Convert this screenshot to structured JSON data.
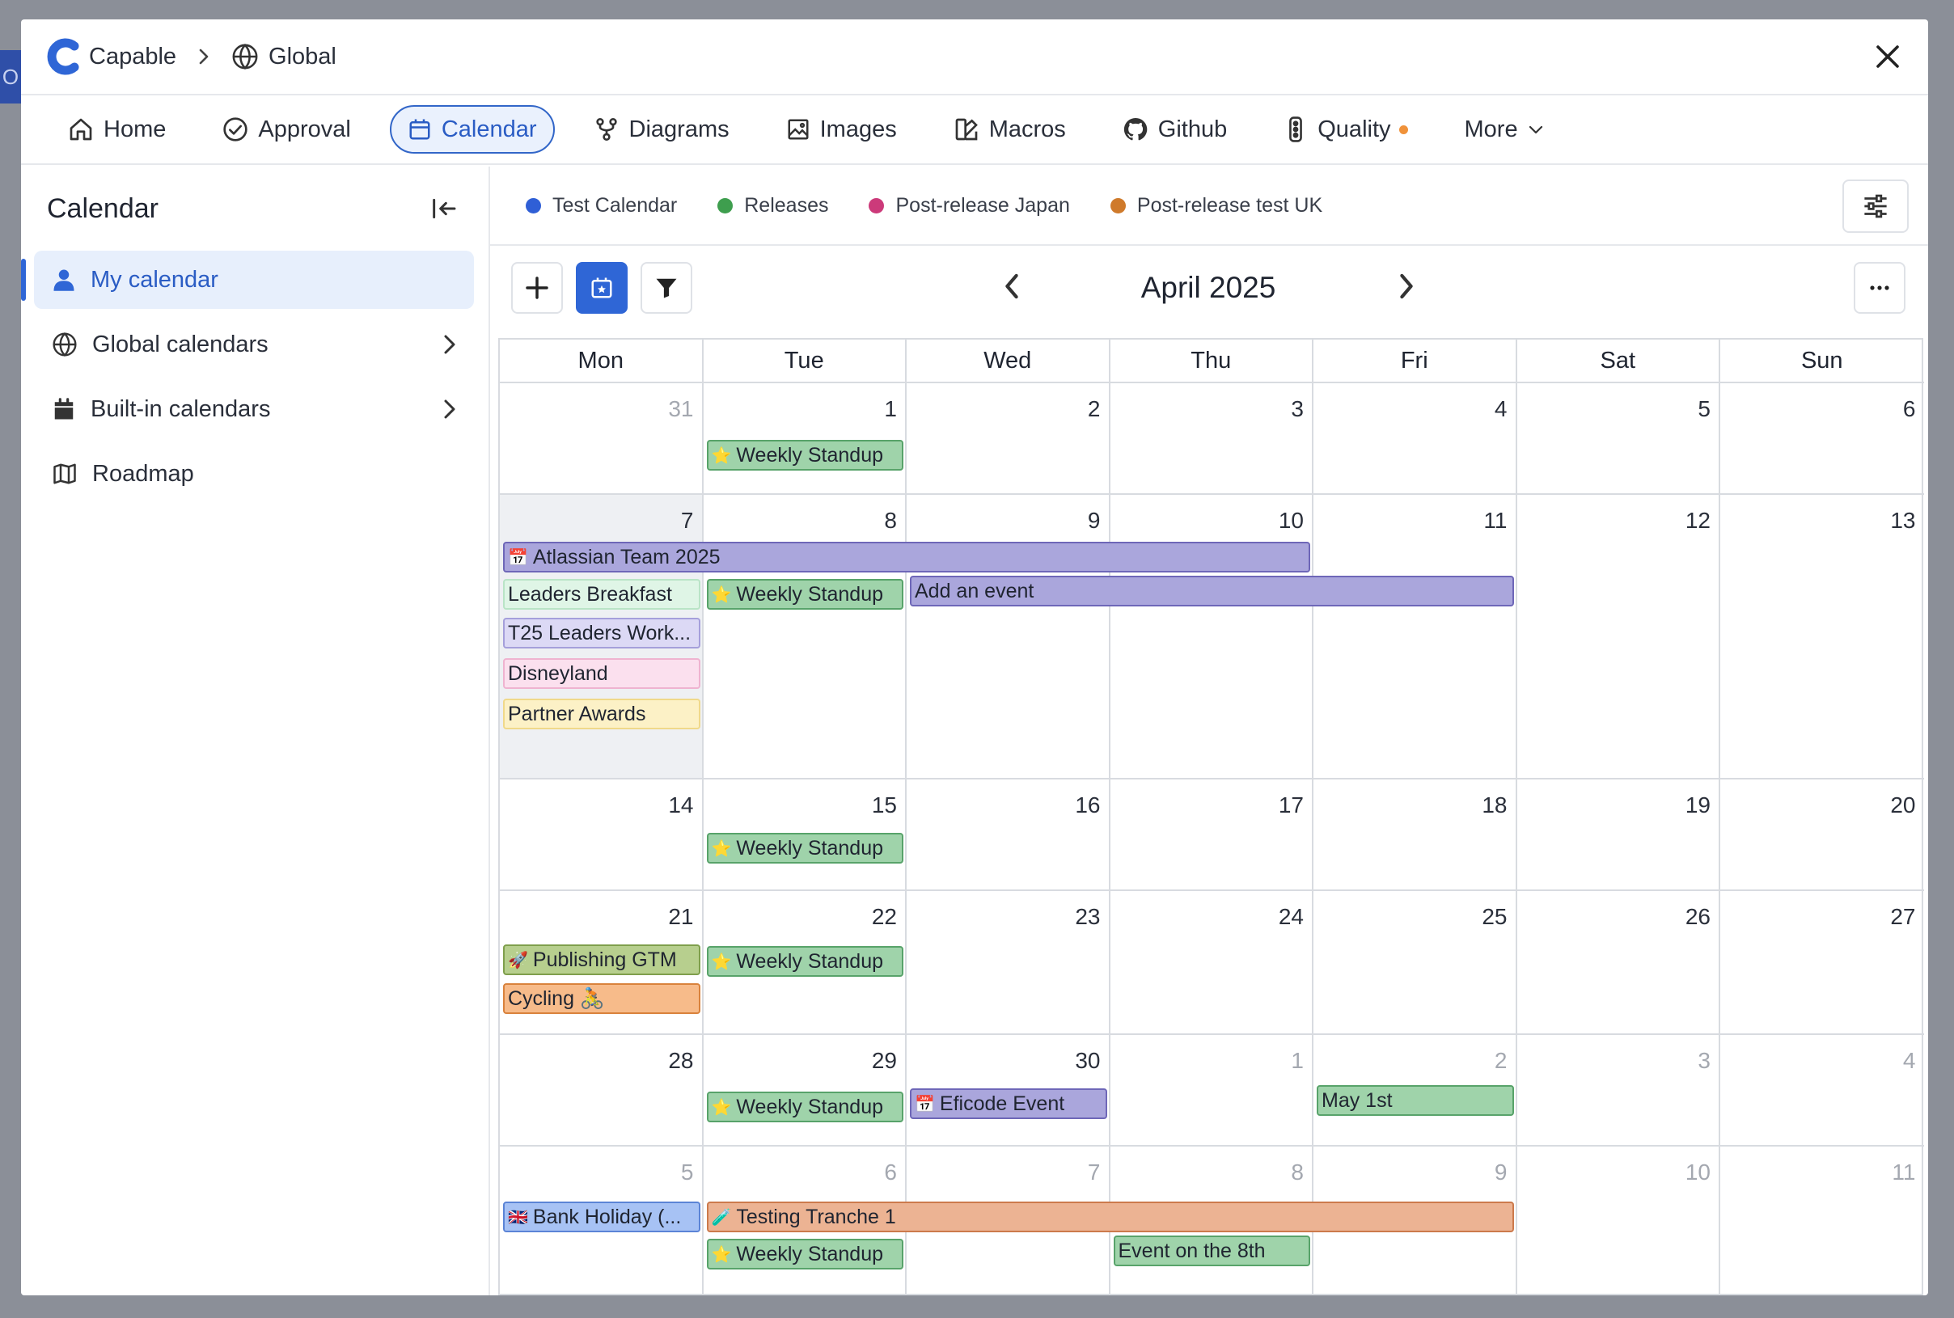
{
  "breadcrumb": [
    "Capable",
    "Global"
  ],
  "nav": [
    {
      "label": "Home",
      "icon": "home-icon"
    },
    {
      "label": "Approval",
      "icon": "check-circle-icon"
    },
    {
      "label": "Calendar",
      "icon": "calendar-icon",
      "active": true
    },
    {
      "label": "Diagrams",
      "icon": "diagram-icon"
    },
    {
      "label": "Images",
      "icon": "image-icon"
    },
    {
      "label": "Macros",
      "icon": "macro-icon"
    },
    {
      "label": "Github",
      "icon": "github-icon"
    },
    {
      "label": "Quality",
      "icon": "traffic-light-icon",
      "badge_color": "#f0923a"
    },
    {
      "label": "More",
      "icon": "chevron-down-icon"
    }
  ],
  "sidebar": {
    "title": "Calendar",
    "items": [
      {
        "label": "My calendar",
        "icon": "user-icon",
        "active": true
      },
      {
        "label": "Global calendars",
        "icon": "globe-icon"
      },
      {
        "label": "Built-in calendars",
        "icon": "calendar-filled-icon"
      },
      {
        "label": "Roadmap",
        "icon": "map-icon"
      }
    ]
  },
  "legend": [
    {
      "label": "Test Calendar",
      "color": "#2f5fd6"
    },
    {
      "label": "Releases",
      "color": "#3e9e4e"
    },
    {
      "label": "Post-release Japan",
      "color": "#cc3a7a"
    },
    {
      "label": "Post-release test UK",
      "color": "#cf7a2b"
    }
  ],
  "toolbar": {
    "month": "April 2025"
  },
  "calendar": {
    "weekdays": [
      "Mon",
      "Tue",
      "Wed",
      "Thu",
      "Fri",
      "Sat",
      "Sun"
    ],
    "weeks": [
      [
        "31",
        "1",
        "2",
        "3",
        "4",
        "5",
        "6"
      ],
      [
        "7",
        "8",
        "9",
        "10",
        "11",
        "12",
        "13"
      ],
      [
        "14",
        "15",
        "16",
        "17",
        "18",
        "19",
        "20"
      ],
      [
        "21",
        "22",
        "23",
        "24",
        "25",
        "26",
        "27"
      ],
      [
        "28",
        "29",
        "30",
        "1",
        "2",
        "3",
        "4"
      ],
      [
        "5",
        "6",
        "7",
        "8",
        "9",
        "10",
        "11"
      ]
    ],
    "events": [
      {
        "title": "Weekly Standup",
        "emoji": "⭐"
      },
      {
        "title": "Atlassian Team 2025",
        "emoji": "📅"
      },
      {
        "title": "Leaders Breakfast",
        "emoji": ""
      },
      {
        "title": "Weekly Standup",
        "emoji": "⭐"
      },
      {
        "title": "Add an event",
        "emoji": ""
      },
      {
        "title": "T25 Leaders Work...",
        "emoji": ""
      },
      {
        "title": "Disneyland",
        "emoji": ""
      },
      {
        "title": "Partner Awards",
        "emoji": ""
      },
      {
        "title": "Weekly Standup",
        "emoji": "⭐"
      },
      {
        "title": "Publishing GTM",
        "emoji": "🚀"
      },
      {
        "title": "Weekly Standup",
        "emoji": "⭐"
      },
      {
        "title": "Cycling 🚴",
        "emoji": ""
      },
      {
        "title": "Weekly Standup",
        "emoji": "⭐"
      },
      {
        "title": "Eficode Event",
        "emoji": "📅"
      },
      {
        "title": "May 1st",
        "emoji": ""
      },
      {
        "title": "Bank Holiday (...",
        "emoji": "🇬🇧"
      },
      {
        "title": "Testing Tranche 1",
        "emoji": "🧪"
      },
      {
        "title": "Weekly Standup",
        "emoji": "⭐"
      },
      {
        "title": "Event on the 8th",
        "emoji": ""
      }
    ]
  }
}
